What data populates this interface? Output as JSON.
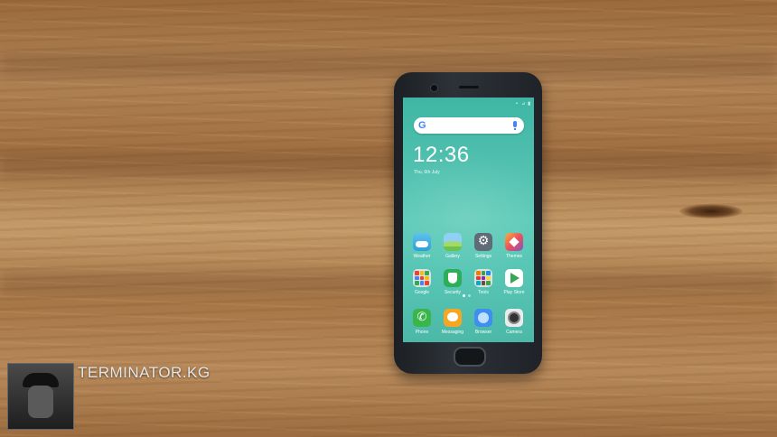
{
  "phone": {
    "clock": "12:36",
    "date": "Thu, 6th July",
    "status": [
      "⚬",
      "⊿",
      "▮"
    ]
  },
  "apps": [
    {
      "label": "Weather",
      "icon": "weather-icon"
    },
    {
      "label": "Gallery",
      "icon": "gallery-icon"
    },
    {
      "label": "Settings",
      "icon": "settings-icon"
    },
    {
      "label": "Themes",
      "icon": "themes-icon"
    },
    {
      "label": "Google",
      "icon": "google-folder-icon"
    },
    {
      "label": "Security",
      "icon": "security-icon"
    },
    {
      "label": "Tools",
      "icon": "tools-folder-icon"
    },
    {
      "label": "Play Store",
      "icon": "playstore-icon"
    }
  ],
  "dock": [
    {
      "label": "Phone",
      "icon": "phone-app-icon"
    },
    {
      "label": "Messaging",
      "icon": "messaging-icon"
    },
    {
      "label": "Browser",
      "icon": "browser-icon"
    },
    {
      "label": "Camera",
      "icon": "camera-app-icon"
    }
  ],
  "search": {
    "logo": "G"
  },
  "watermark": {
    "text": "TERMINATOR.KG"
  }
}
